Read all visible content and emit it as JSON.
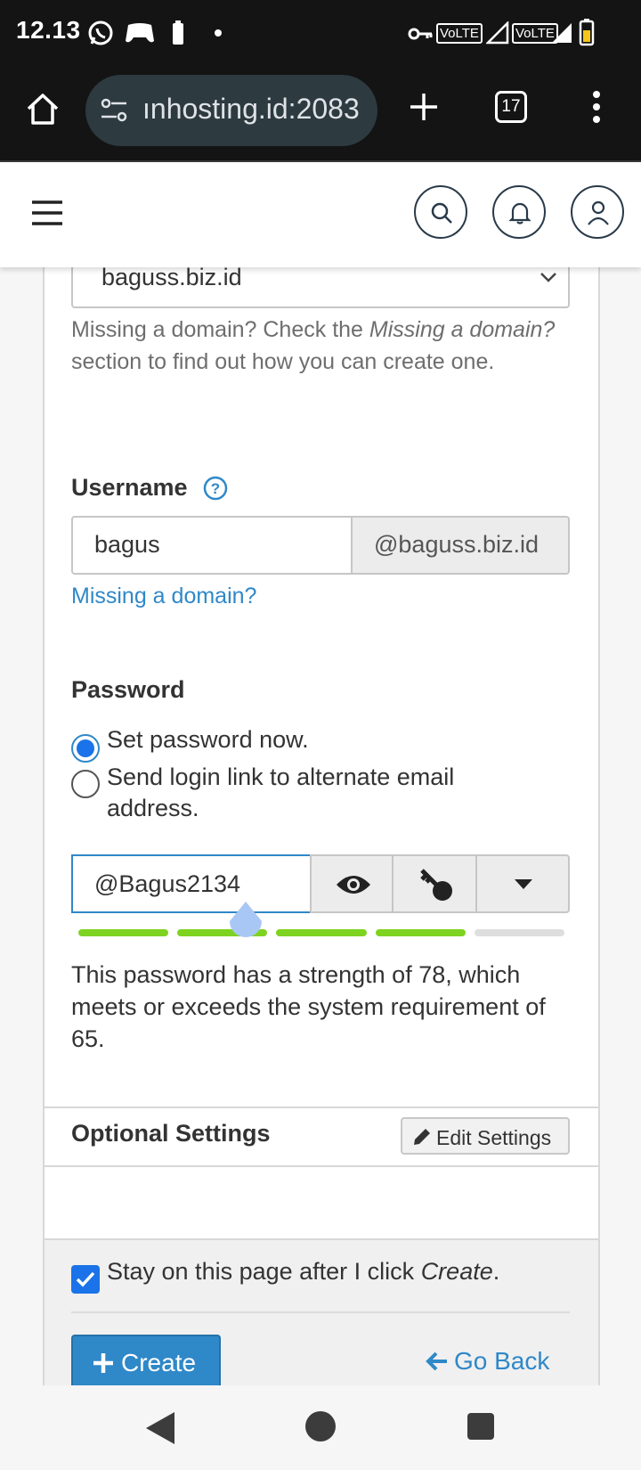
{
  "status_bar": {
    "time": "12.13",
    "volte1": "VoLTE",
    "volte2": "VoLTE"
  },
  "browser": {
    "url": "ınhosting.id:2083",
    "tab_count": "17"
  },
  "form": {
    "domain_select_value": "baguss.biz.id",
    "domain_help_prefix": "Missing a domain? Check the ",
    "domain_help_em": "Missing a domain?",
    "domain_help_suffix": " section to find out how you can create one.",
    "username_label": "Username",
    "username_value": "bagus",
    "username_suffix": "@baguss.biz.id",
    "missing_domain_link": "Missing a domain?",
    "password_label": "Password",
    "radio_set_now": "Set password now.",
    "radio_send_link": "Send login link to alternate email address.",
    "password_value": "@Bagus2134",
    "strength_segments_filled": 4,
    "strength_segments_total": 5,
    "strength_text": "This password has a strength of 78, which meets or exceeds the system requirement of 65.",
    "optional_settings_label": "Optional Settings",
    "edit_settings_label": "Edit Settings",
    "stay_prefix": "Stay on this page after I click ",
    "stay_em": "Create",
    "stay_suffix": ".",
    "create_label": "Create",
    "go_back_label": "Go Back"
  },
  "colors": {
    "accent_blue": "#2f88c8",
    "strength_green": "#7ed321",
    "strength_empty": "#dedede"
  }
}
